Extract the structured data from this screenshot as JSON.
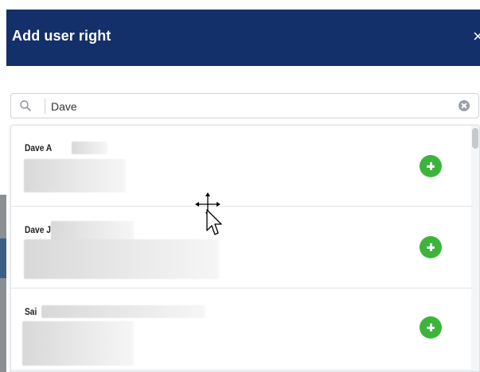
{
  "dialog": {
    "title": "Add user right",
    "close_label": "×"
  },
  "search": {
    "value": "Dave",
    "icon": "search-icon",
    "clear_icon": "clear-icon"
  },
  "results": [
    {
      "name": "Dave A"
    },
    {
      "name": "Dave J"
    },
    {
      "name": "Sai"
    }
  ],
  "colors": {
    "header_bg": "#14306b",
    "add_button": "#3cb43c"
  }
}
